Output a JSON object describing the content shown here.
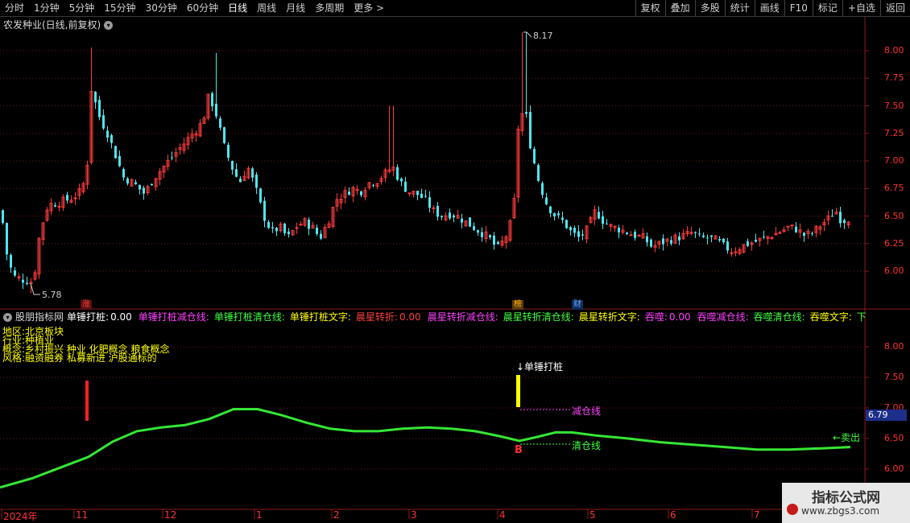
{
  "toolbar": {
    "periods": [
      "分时",
      "1分钟",
      "5分钟",
      "15分钟",
      "30分钟",
      "60分钟",
      "日线",
      "周线",
      "月线",
      "多周期",
      "更多 >"
    ],
    "active_period": "日线",
    "buttons": [
      "复权",
      "叠加",
      "多股",
      "统计",
      "画线",
      "F10",
      "标记",
      "+自选",
      "返回"
    ]
  },
  "chart": {
    "title": "农发种业(日线,前复权)",
    "expand_icon": "chevron-down-icon",
    "high_label": "8.17",
    "low_label": "5.78",
    "price_axis": [
      "8.00",
      "7.75",
      "7.50",
      "7.25",
      "7.00",
      "6.75",
      "6.50",
      "6.25",
      "6.00"
    ],
    "markers": [
      {
        "text": "涨",
        "color": "#ff4040",
        "bg": "#5a1010"
      },
      {
        "text": "榜",
        "color": "#ffb000",
        "bg": "#5a3a10"
      },
      {
        "text": "财",
        "color": "#6aa8ff",
        "bg": "#102a5a"
      }
    ]
  },
  "indicator": {
    "name": "股朋指标网",
    "fields": [
      {
        "label": "单锤打桩:",
        "value": "0.00",
        "color": "#ffffff"
      },
      {
        "label": "单锤打桩减仓线:",
        "value": "",
        "color": "#ff40ff"
      },
      {
        "label": "单锤打桩清仓线:",
        "value": "",
        "color": "#40ff40"
      },
      {
        "label": "单锤打桩文字:",
        "value": "",
        "color": "#ffff00"
      },
      {
        "label": "晨星转折:",
        "value": "0.00",
        "color": "#ff4040"
      },
      {
        "label": "晨星转折减仓线:",
        "value": "",
        "color": "#ff40ff"
      },
      {
        "label": "晨星转折清仓线:",
        "value": "",
        "color": "#40ff40"
      },
      {
        "label": "晨星转折文字:",
        "value": "",
        "color": "#ffff00"
      },
      {
        "label": "吞噬:",
        "value": "0.00",
        "color": "#ff40ff"
      },
      {
        "label": "吞噬减仓线:",
        "value": "",
        "color": "#ff40ff"
      },
      {
        "label": "吞噬清仓线:",
        "value": "",
        "color": "#40ff40"
      },
      {
        "label": "吞噬文字:",
        "value": "",
        "color": "#ffff00"
      },
      {
        "label": "下降突破",
        "value": "",
        "color": "#40ff40"
      }
    ],
    "info_lines": [
      "地区:北京板块",
      "行业:种植业",
      "概念:乡村振兴 种业 化肥概念 粮食概念",
      "风格:融资融券 私募新进 沪股通标的"
    ],
    "price_axis": [
      "8.00",
      "7.50",
      "7.00",
      "6.50",
      "6.00"
    ],
    "current_price": "6.79",
    "signal_label": "↓单锤打桩",
    "reduce_label": "减仓线",
    "clear_label": "清仓线",
    "buy_label": "B",
    "sell_label": "←卖出"
  },
  "date_axis": [
    "2024年",
    "11",
    "12",
    "1",
    "2",
    "3",
    "4",
    "5",
    "6",
    "7"
  ],
  "watermark": {
    "title": "指标公式网",
    "url": "www.zbgs3.com"
  }
}
